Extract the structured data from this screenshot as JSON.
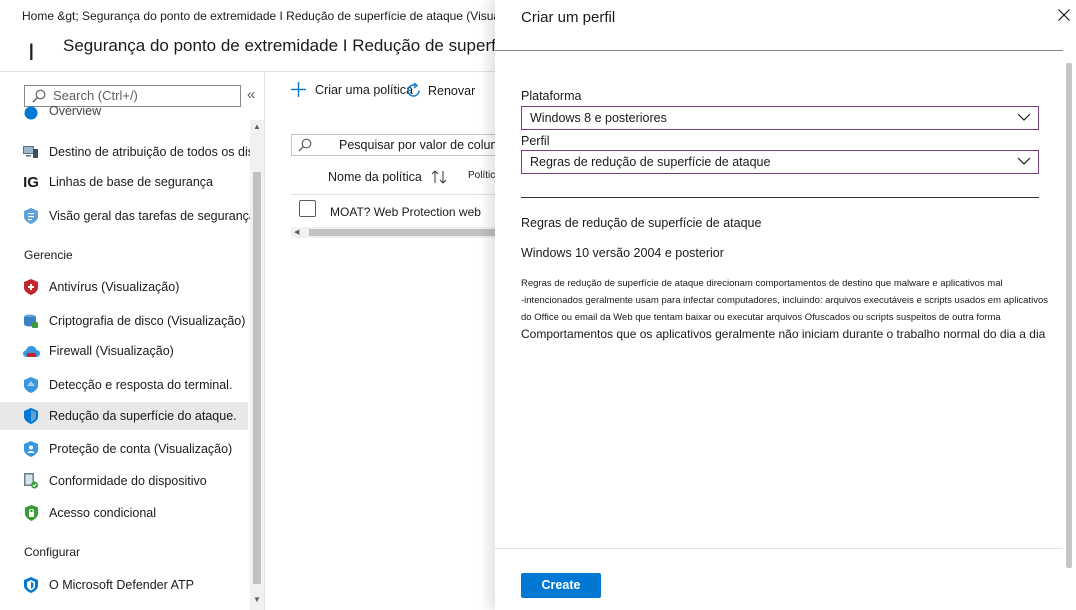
{
  "breadcrumb": "Home &gt;  Segurança do ponto de extremidade I Redução de superfície de ataque (Visualização)",
  "header": {
    "glyph": "I",
    "title": "Segurança do ponto de extremidade I Redução de superfície de ataque (Visualização'"
  },
  "sidebar": {
    "search_placeholder": "Search (Ctrl+/)",
    "collapse_glyph": "«",
    "items": [
      {
        "label": "Overview",
        "icon": "info-icon"
      },
      {
        "label": "Destino de atribuição de todos os dispositivos",
        "icon": "devices-icon"
      },
      {
        "label": "Linhas de base de segurança",
        "icon": "ig-icon",
        "glyph": "IG"
      },
      {
        "label": "Visão geral das tarefas de segurança",
        "icon": "task-list-icon"
      },
      {
        "label": "Antivírus (Visualização)",
        "icon": "antivirus-shield-icon"
      },
      {
        "label": "Criptografia de disco (Visualização)",
        "icon": "disk-encryption-icon"
      },
      {
        "label": "Firewall (Visualização)",
        "icon": "firewall-icon"
      },
      {
        "label": "Detecção e resposta do terminal.",
        "icon": "endpoint-detection-icon"
      },
      {
        "label": "Redução da superfície do ataque.",
        "icon": "attack-surface-shield-icon"
      },
      {
        "label": "Proteção de conta (Visualização)",
        "icon": "account-protection-icon"
      },
      {
        "label": "Conformidade do dispositivo",
        "icon": "device-compliance-icon"
      },
      {
        "label": "Acesso condicional",
        "icon": "conditional-access-icon"
      },
      {
        "label": "O Microsoft Defender ATP",
        "icon": "defender-shield-icon"
      }
    ],
    "sections": {
      "manage": "Gerencie",
      "configure": "Configurar"
    }
  },
  "main": {
    "create_policy": "Criar uma política",
    "refresh": "Renovar",
    "filter_placeholder": "Pesquisar por valor de coluna",
    "col_name": "Nome da política",
    "col_policy": "Política",
    "row_name": "MOAT? Web Protection web"
  },
  "panel": {
    "title": "Criar um perfil",
    "platform_label": "Plataforma",
    "platform_value": "Windows 8 e posteriores",
    "profile_label": "Perfil",
    "profile_value": "Regras de redução de superfície de ataque",
    "desc_heading": "Regras de redução de superfície de ataque",
    "desc_version": "Windows 10 versão 2004 e posterior",
    "desc_line1": "Regras de redução de superfície de ataque direcionam comportamentos de destino que malware e aplicativos mal",
    "desc_line2": "-intencionados geralmente usam para infectar computadores, incluindo: arquivos executáveis e scripts usados em aplicativos",
    "desc_line3": "do Office ou email da Web que tentam baixar ou executar arquivos Ofuscados ou scripts suspeitos de outra forma",
    "desc_line4": "Comportamentos que os aplicativos geralmente não iniciam durante o trabalho normal do dia a dia",
    "create_button": "Create"
  },
  "colors": {
    "accent": "#0078d4",
    "dropdown_border": "#7a3f80",
    "selected_bg": "#e8e8e8"
  }
}
